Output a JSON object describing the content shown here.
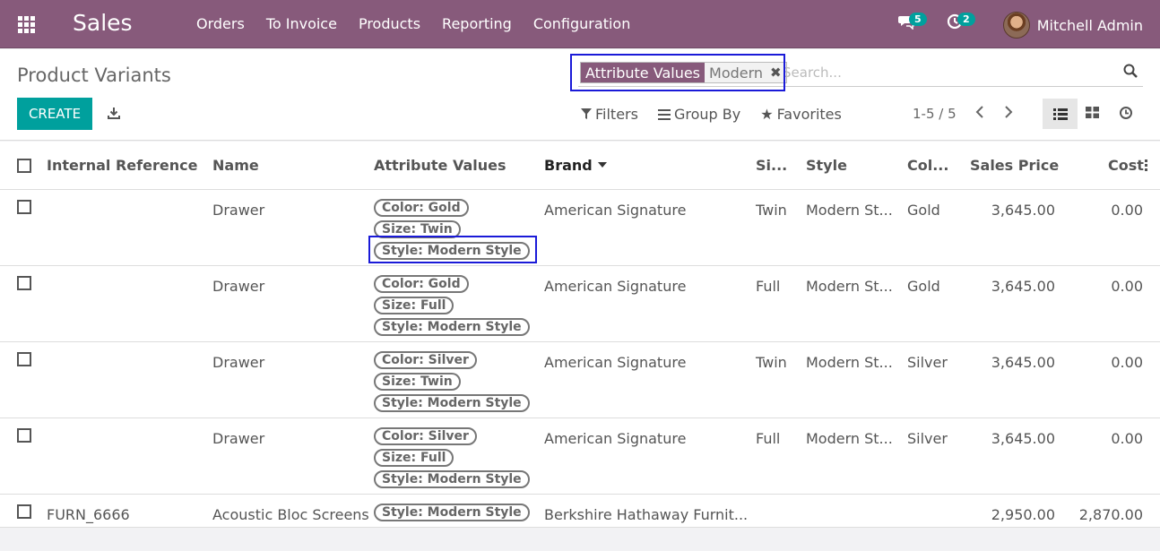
{
  "navbar": {
    "brand": "Sales",
    "menu": [
      "Orders",
      "To Invoice",
      "Products",
      "Reporting",
      "Configuration"
    ],
    "messages_badge": "5",
    "activities_badge": "2",
    "user_name": "Mitchell Admin",
    "color": "#875a7b"
  },
  "control": {
    "title": "Product Variants",
    "facet_label": "Attribute Values",
    "facet_value": "Modern",
    "search_placeholder": "Search...",
    "create_label": "CREATE",
    "filters_label": "Filters",
    "groupby_label": "Group By",
    "favorites_label": "Favorites",
    "pager": "1-5 / 5",
    "accent": "#00a09d"
  },
  "table": {
    "headers": {
      "internal_reference": "Internal Reference",
      "name": "Name",
      "attribute_values": "Attribute Values",
      "brand": "Brand",
      "size": "Si...",
      "style": "Style",
      "color": "Col...",
      "sales_price": "Sales Price",
      "cost": "Cost"
    },
    "rows": [
      {
        "ref": "",
        "name": "Drawer",
        "tags": [
          "Color: Gold",
          "Size: Twin",
          "Style: Modern Style"
        ],
        "brand": "American Signature",
        "size": "Twin",
        "style": "Modern St...",
        "color": "Gold",
        "price": "3,645.00",
        "cost": "0.00"
      },
      {
        "ref": "",
        "name": "Drawer",
        "tags": [
          "Color: Gold",
          "Size: Full",
          "Style: Modern Style"
        ],
        "brand": "American Signature",
        "size": "Full",
        "style": "Modern St...",
        "color": "Gold",
        "price": "3,645.00",
        "cost": "0.00"
      },
      {
        "ref": "",
        "name": "Drawer",
        "tags": [
          "Color: Silver",
          "Size: Twin",
          "Style: Modern Style"
        ],
        "brand": "American Signature",
        "size": "Twin",
        "style": "Modern St...",
        "color": "Silver",
        "price": "3,645.00",
        "cost": "0.00"
      },
      {
        "ref": "",
        "name": "Drawer",
        "tags": [
          "Color: Silver",
          "Size: Full",
          "Style: Modern Style"
        ],
        "brand": "American Signature",
        "size": "Full",
        "style": "Modern St...",
        "color": "Silver",
        "price": "3,645.00",
        "cost": "0.00"
      },
      {
        "ref": "FURN_6666",
        "name": "Acoustic Bloc Screens",
        "tags": [
          "Style: Modern Style"
        ],
        "brand": "Berkshire Hathaway Furnit...",
        "size": "",
        "style": "",
        "color": "",
        "price": "2,950.00",
        "cost": "2,870.00"
      }
    ]
  }
}
